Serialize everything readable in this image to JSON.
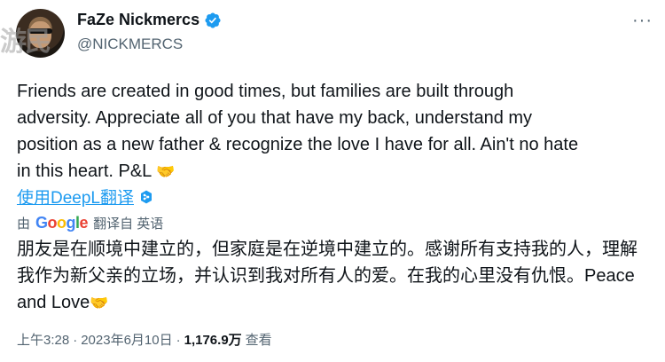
{
  "user": {
    "display_name": "FaZe Nickmercs",
    "handle": "@NICKMERCS"
  },
  "watermark_text": "游民",
  "more_label": "···",
  "tweet": {
    "text": "Friends are created in good times, but families are built through adversity. Appreciate all of you that have my back, understand my position as a new father & recognize the love I have for all. Ain't no hate in this heart. P&L",
    "emoji": "🤝"
  },
  "translate": {
    "link_label": "使用DeepL翻译",
    "by_prefix": "由",
    "google_letters": [
      "G",
      "o",
      "o",
      "g",
      "l",
      "e"
    ],
    "by_suffix": "翻译自 英语",
    "translated_text": "朋友是在顺境中建立的，但家庭是在逆境中建立的。感谢所有支持我的人，理解我作为新父亲的立场，并认识到我对所有人的爱。在我的心里没有仇恨。Peace and Love",
    "emoji": "🤝"
  },
  "meta": {
    "time": "上午3:28",
    "separator": "·",
    "date": "2023年6月10日",
    "separator2": "·",
    "views": "1,176.9万",
    "views_label": "查看"
  },
  "colors": {
    "link": "#1d9bf0",
    "verified": "#1d9bf0",
    "muted": "#536471"
  },
  "icons": [
    "verified-badge-icon",
    "more-icon",
    "deepl-icon",
    "handshake-emoji"
  ]
}
